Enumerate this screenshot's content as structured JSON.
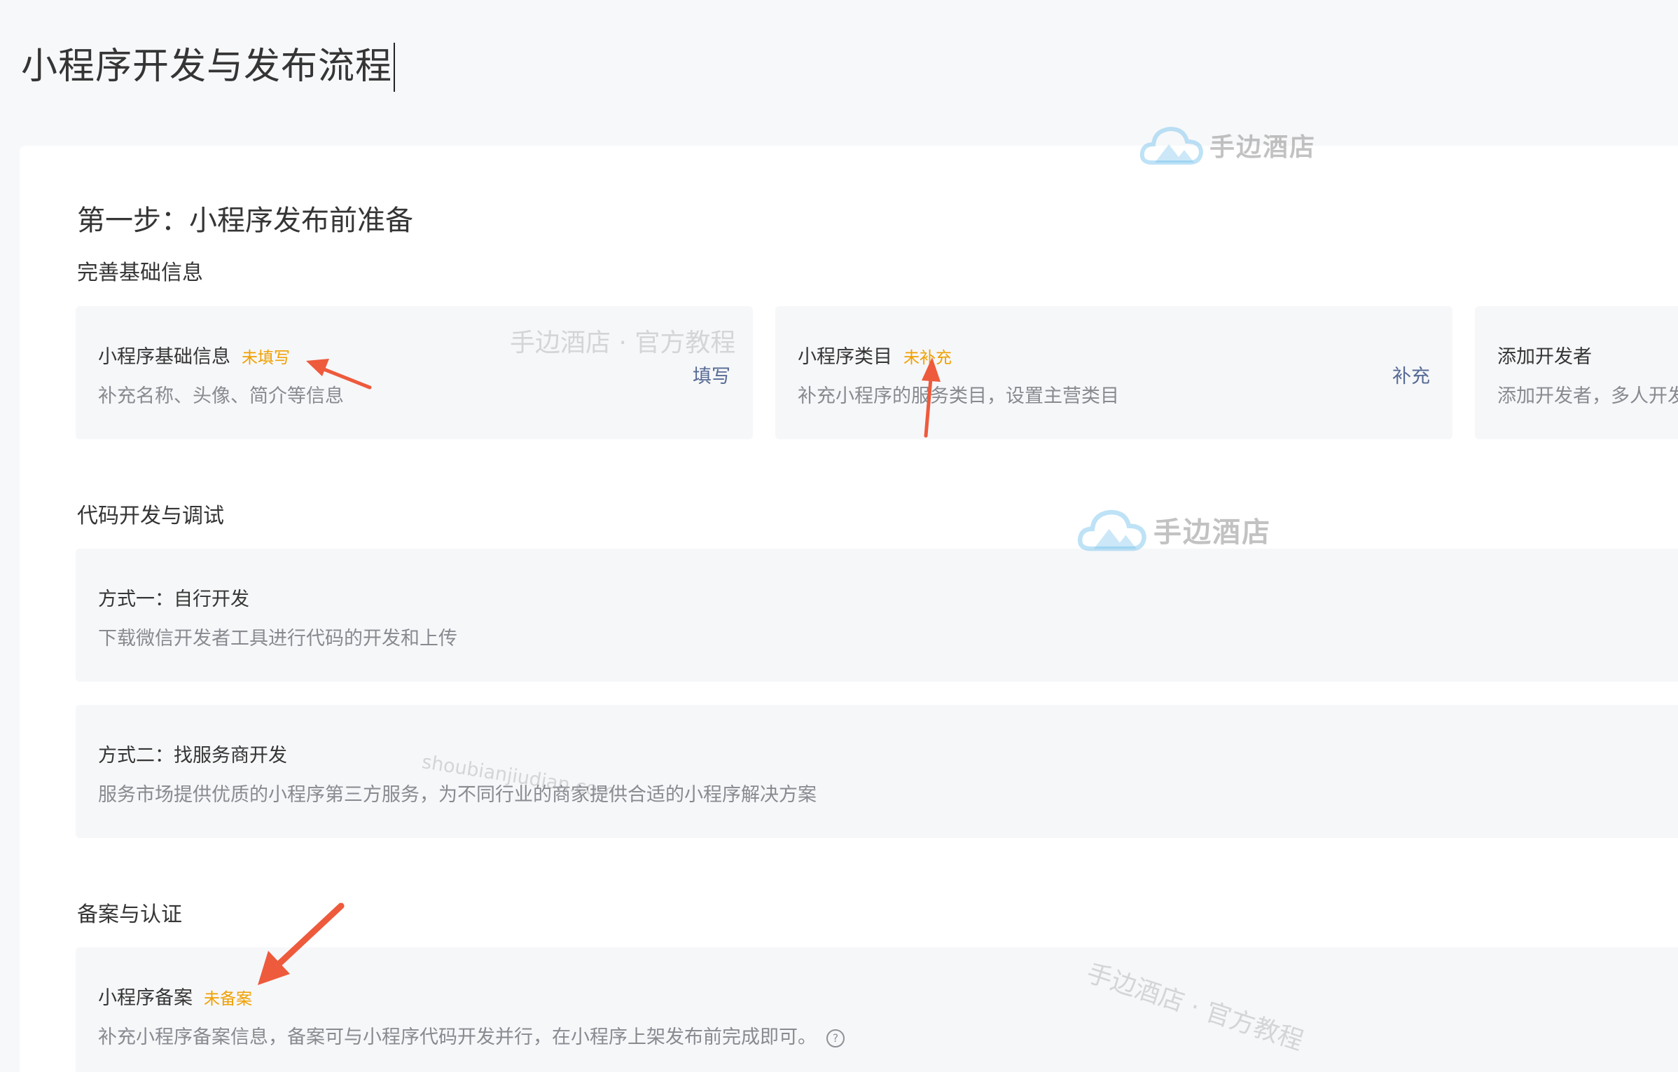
{
  "page_title": "小程序开发与发布流程",
  "step": {
    "title": "第一步：小程序发布前准备"
  },
  "sections": {
    "basic": {
      "title": "完善基础信息",
      "cards": [
        {
          "title": "小程序基础信息",
          "status": "未填写",
          "desc": "补充名称、头像、简介等信息",
          "action": "填写"
        },
        {
          "title": "小程序类目",
          "status": "未补充",
          "desc": "补充小程序的服务类目，设置主营类目",
          "action": "补充"
        },
        {
          "title": "添加开发者",
          "desc": "添加开发者，多人开发"
        }
      ]
    },
    "dev": {
      "title": "代码开发与调试",
      "items": [
        {
          "title": "方式一：自行开发",
          "desc": "下载微信开发者工具进行代码的开发和上传"
        },
        {
          "title": "方式二：找服务商开发",
          "desc": "服务市场提供优质的小程序第三方服务，为不同行业的商家提供合适的小程序解决方案"
        }
      ]
    },
    "record": {
      "title": "备案与认证",
      "items": [
        {
          "title": "小程序备案",
          "status": "未备案",
          "desc": "补充小程序备案信息，备案可与小程序代码开发并行，在小程序上架发布前完成即可。",
          "help_icon": "question-circle-icon"
        }
      ]
    }
  },
  "watermarks": {
    "logo_text": "手边酒店",
    "tagline": "手边酒店 · 官方教程",
    "domain": "shoubianjiudian.com"
  },
  "colors": {
    "status": "#f0a000",
    "link": "#576b95",
    "annotation_arrow": "#ee5a3c",
    "card_bg": "#f6f7f9",
    "page_bg": "#f7f8fa"
  }
}
